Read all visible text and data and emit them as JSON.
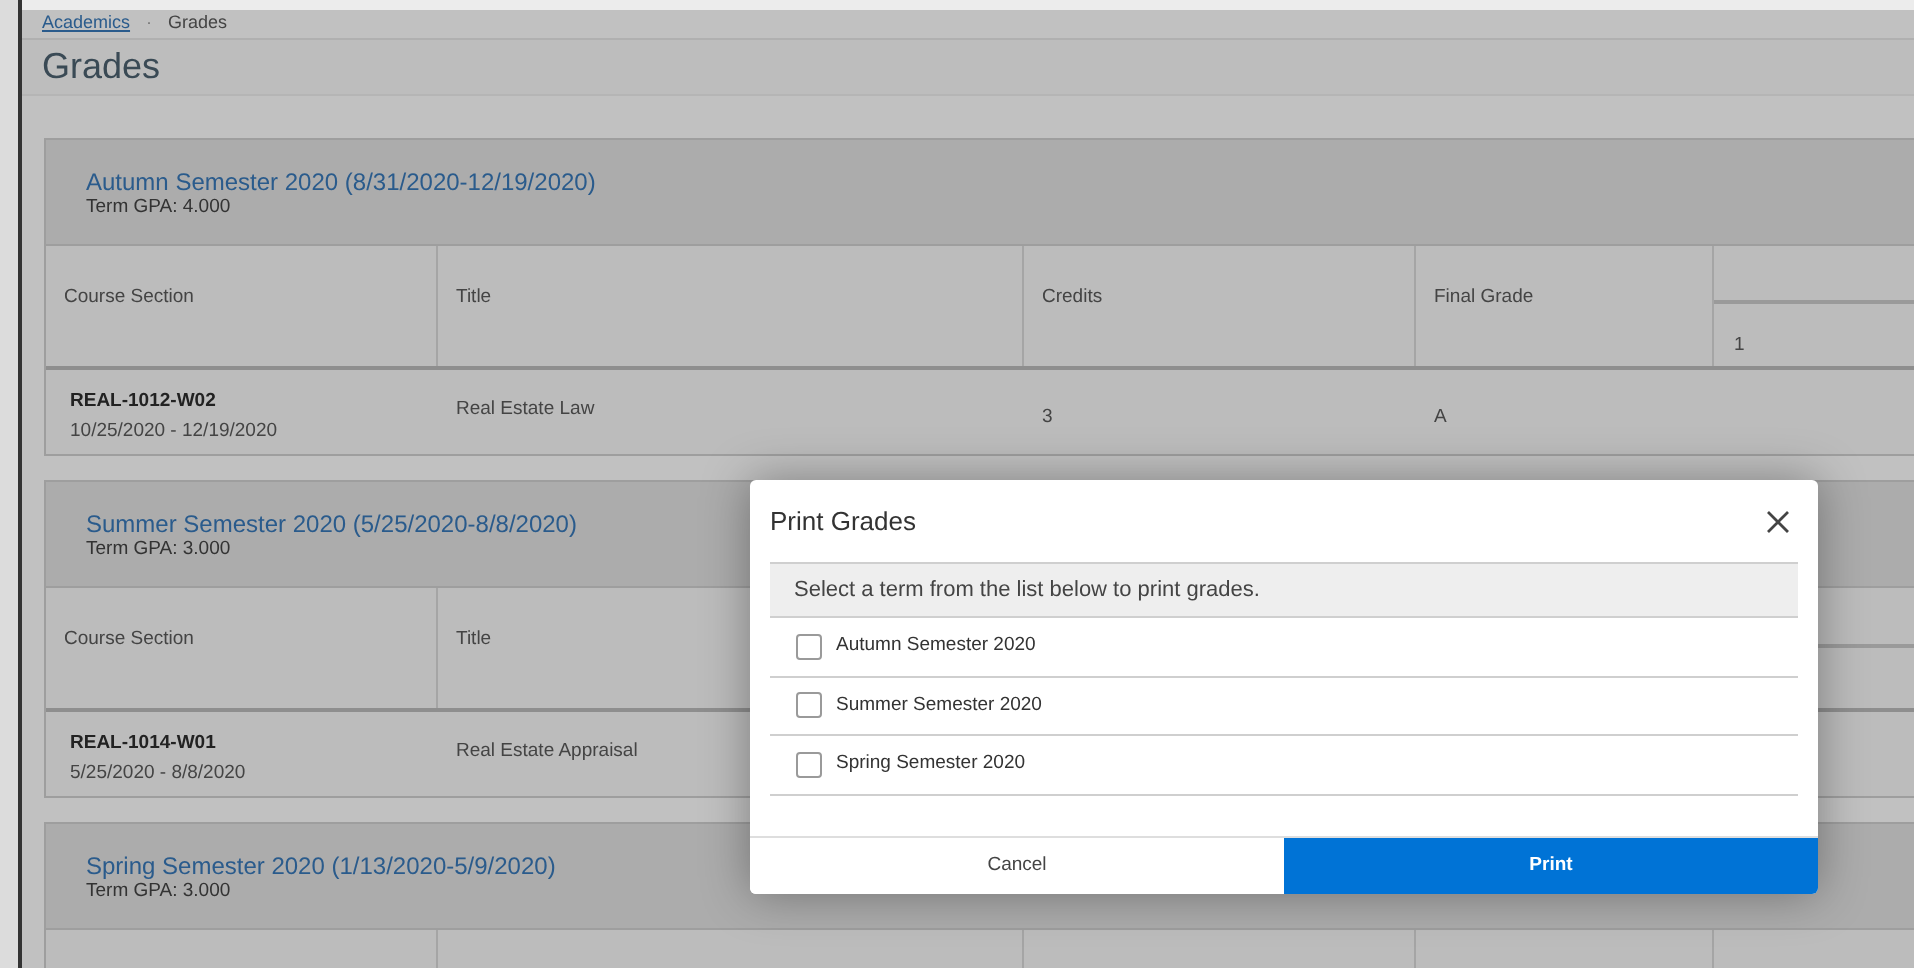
{
  "breadcrumb": [
    {
      "label": "Academics",
      "kind": "link"
    },
    {
      "label": "·",
      "kind": "separator"
    },
    {
      "label": "Grades",
      "kind": "current"
    }
  ],
  "page_title": "Grades",
  "terms": [
    {
      "title": "Autumn Semester 2020 (8/31/2020-12/19/2020)",
      "gpa": "Term GPA: 4.000",
      "columns": [
        "Course Section",
        "Title",
        "Credits",
        "Final Grade"
      ],
      "column_5_sub": "1",
      "courses": [
        {
          "section": "REAL-1012-W02",
          "dates": "10/25/2020 - 12/19/2020",
          "title": "Real Estate Law",
          "credits": "3",
          "grade": "A"
        }
      ]
    },
    {
      "title": "Summer Semester 2020 (5/25/2020-8/8/2020)",
      "gpa": "Term GPA: 3.000",
      "columns": [
        "Course Section",
        "Title"
      ],
      "courses": [
        {
          "section": "REAL-1014-W01",
          "dates": "5/25/2020 - 8/8/2020",
          "title": "Real Estate Appraisal"
        }
      ]
    },
    {
      "title": "Spring Semester 2020 (1/13/2020-5/9/2020)",
      "gpa": "Term GPA: 3.000"
    }
  ],
  "dialog": {
    "title": "Print Grades",
    "instruction": "Select a term from the list below to print grades.",
    "options": [
      {
        "label": "Autumn Semester 2020",
        "checked": false
      },
      {
        "label": "Summer Semester 2020",
        "checked": false
      },
      {
        "label": "Spring Semester 2020",
        "checked": false
      }
    ],
    "buttons": [
      {
        "label": "Cancel",
        "kind": "secondary"
      },
      {
        "label": "Print",
        "kind": "primary"
      }
    ]
  }
}
